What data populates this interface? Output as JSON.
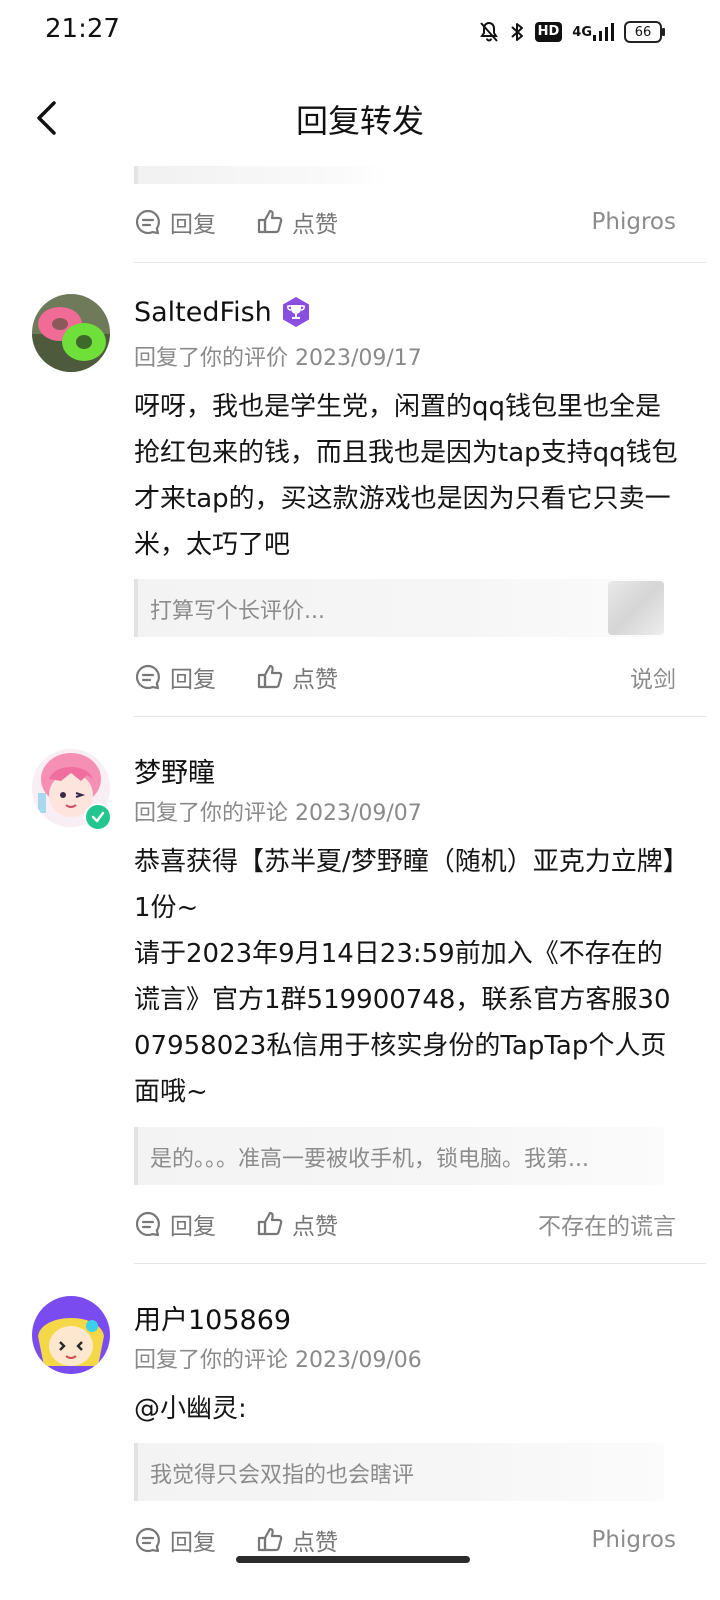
{
  "status_bar": {
    "time": "21:27",
    "network": "4G",
    "hd": "HD",
    "battery": "66"
  },
  "header": {
    "title": "回复转发"
  },
  "labels": {
    "reply": "回复",
    "like": "点赞"
  },
  "top_item": {
    "source": "Phigros"
  },
  "items": [
    {
      "username": "SaltedFish",
      "meta": "回复了你的评价 2023/09/17",
      "text": "呀呀，我也是学生党，闲置的qq钱包里也全是抢红包来的钱，而且我也是因为tap支持qq钱包才来tap的，买这款游戏也是因为只看它只卖一米，太巧了吧",
      "quote": "打算写个长评价...",
      "source": "说剑"
    },
    {
      "username": "梦野瞳",
      "meta": "回复了你的评论 2023/09/07",
      "text": "恭喜获得【苏半夏/梦野瞳（随机）亚克力立牌】1份~\n请于2023年9月14日23:59前加入《不存在的谎言》官方1群519900748，联系官方客服3007958023私信用于核实身份的TapTap个人页面哦~",
      "quote": "是的。。。准高一要被收手机，锁电脑。我第...",
      "source": "不存在的谎言"
    },
    {
      "username": "用户105869",
      "meta": "回复了你的评论 2023/09/06",
      "text": "@小幽灵:",
      "quote": "我觉得只会双指的也会瞎评",
      "source": "Phigros"
    }
  ],
  "colors": {
    "text": "#151515",
    "muted": "#8a8a8a",
    "divider": "#e6e6e6",
    "badge_purple": "#8a4fe0",
    "verified_green": "#24c68f"
  }
}
